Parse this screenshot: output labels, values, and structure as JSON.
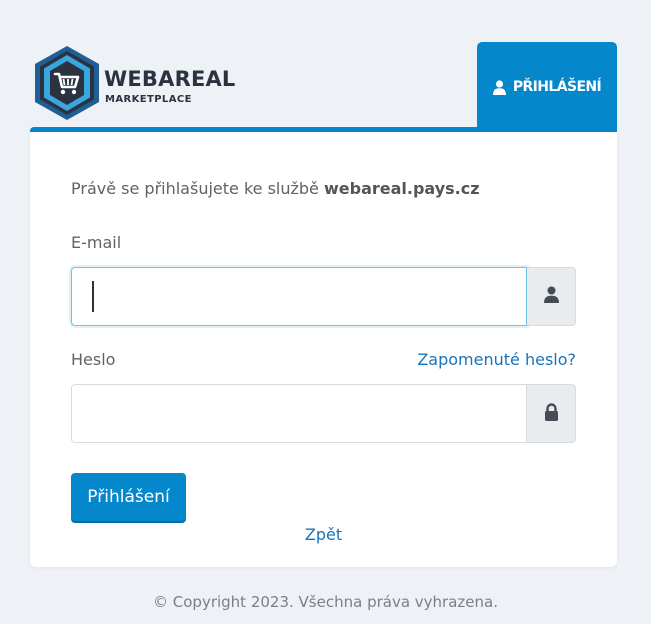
{
  "brand": {
    "name": "WEBAREAL",
    "subtitle": "MARKETPLACE",
    "colors": {
      "primary": "#0587cc",
      "dark": "#2b3340"
    }
  },
  "tab": {
    "label": "PŘIHLÁŠENÍ",
    "icon": "user-icon"
  },
  "form": {
    "intro_prefix": "Právě se přihlašujete ke službě ",
    "intro_service": "webareal.pays.cz",
    "email_label": "E-mail",
    "email_value": "",
    "email_icon": "user-icon",
    "password_label": "Heslo",
    "password_value": "",
    "password_icon": "lock-icon",
    "forgot_label": "Zapomenuté heslo?",
    "submit_label": "Přihlášení",
    "back_label": "Zpět"
  },
  "footer": {
    "copyright": "© Copyright 2023. Všechna práva vyhrazena."
  }
}
